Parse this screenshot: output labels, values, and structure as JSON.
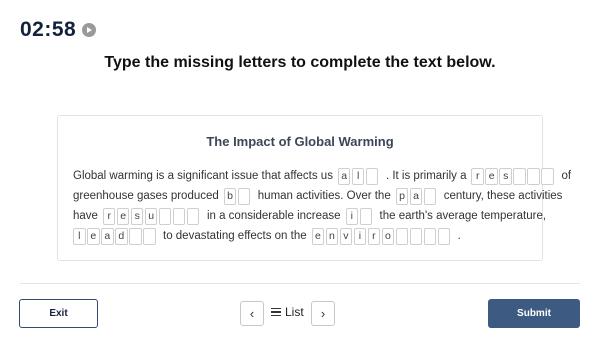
{
  "timer": {
    "time": "02:58",
    "icon": "play-icon"
  },
  "instruction": "Type the missing letters to complete the text below.",
  "passage": {
    "title": "The Impact of Global Warming",
    "lines": [
      [
        {
          "t": "Global warming is a significant issue that affects us"
        },
        {
          "g": [
            "a",
            "l",
            ""
          ]
        },
        {
          "t": ".  It is primarily a"
        },
        {
          "g": [
            "r",
            "e",
            "s",
            "",
            "",
            ""
          ]
        },
        {
          "t": "of"
        }
      ],
      [
        {
          "t": "greenhouse gases produced"
        },
        {
          "g": [
            "b",
            ""
          ]
        },
        {
          "t": "human activities. Over the"
        },
        {
          "g": [
            "p",
            "a",
            ""
          ]
        },
        {
          "t": "century, these activities"
        }
      ],
      [
        {
          "t": "have"
        },
        {
          "g": [
            "r",
            "e",
            "s",
            "u",
            "",
            "",
            ""
          ]
        },
        {
          "t": "in a considerable increase"
        },
        {
          "g": [
            "i",
            ""
          ]
        },
        {
          "t": "the earth's average temperature,"
        }
      ],
      [
        {
          "g": [
            "l",
            "e",
            "a",
            "d",
            "",
            ""
          ]
        },
        {
          "t": "to devastating effects on the"
        },
        {
          "g": [
            "e",
            "n",
            "v",
            "i",
            "r",
            "o",
            "",
            "",
            "",
            ""
          ]
        },
        {
          "t": "."
        }
      ]
    ]
  },
  "footer": {
    "exit_label": "Exit",
    "prev_icon": "chevron-left-icon",
    "list_label": "List",
    "next_icon": "chevron-right-icon",
    "submit_label": "Submit"
  },
  "colors": {
    "primary": "#3d5a82",
    "timer_text": "#14213d"
  }
}
